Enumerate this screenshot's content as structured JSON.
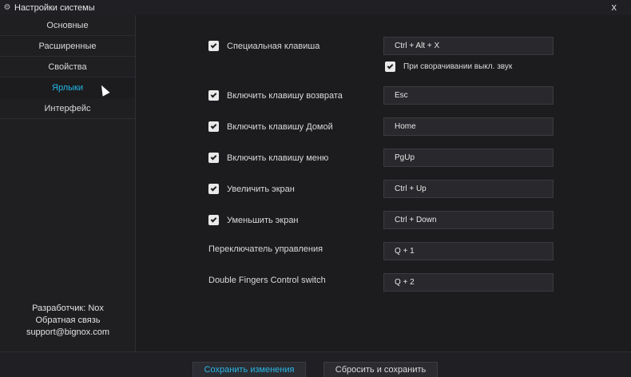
{
  "window": {
    "title": "Настройки системы",
    "close": "x",
    "gear": "⚙"
  },
  "sidebar": {
    "items": [
      {
        "label": "Основные"
      },
      {
        "label": "Расширенные"
      },
      {
        "label": "Свойства"
      },
      {
        "label": "Ярлыки"
      },
      {
        "label": "Интерфейс"
      }
    ],
    "active_item": "Ярлыки",
    "info": {
      "developer": "Разработчик: Nox",
      "feedback": "Обратная связь",
      "email": "support@bignox.com"
    }
  },
  "shortcuts": [
    {
      "label": "Специальная клавиша",
      "checked": true,
      "value": "Ctrl + Alt + X"
    },
    {
      "label": "При сворачивании выкл. звук",
      "checked": true
    },
    {
      "label": "Включить клавишу возврата",
      "checked": true,
      "value": "Esc"
    },
    {
      "label": "Включить клавишу Домой",
      "checked": true,
      "value": "Home"
    },
    {
      "label": "Включить клавишу меню",
      "checked": true,
      "value": "PgUp"
    },
    {
      "label": "Увеличить экран",
      "checked": true,
      "value": "Ctrl + Up"
    },
    {
      "label": "Уменьшить экран",
      "checked": true,
      "value": "Ctrl + Down"
    },
    {
      "label": "Переключатель управления",
      "value": "Q + 1"
    },
    {
      "label": "Double Fingers Control switch",
      "value": "Q + 2"
    }
  ],
  "footer": {
    "save_label": "Сохранить изменения",
    "reset_label": "Сбросить и сохранить"
  },
  "colors": {
    "accent": "#22b8e8",
    "background": "#1c1c1f"
  }
}
